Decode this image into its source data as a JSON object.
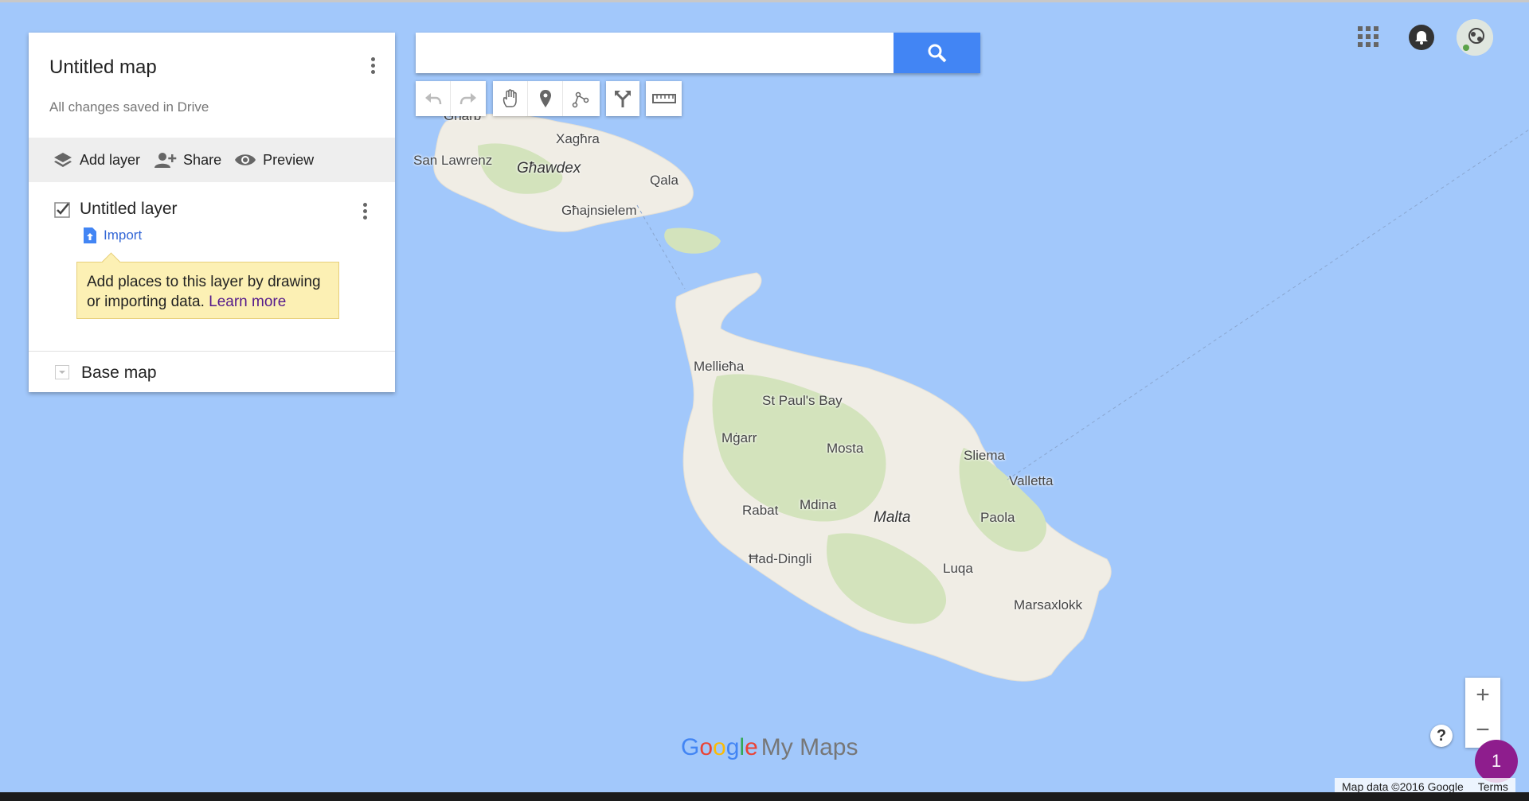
{
  "panel": {
    "map_title": "Untitled map",
    "save_status": "All changes saved in Drive",
    "actions": {
      "add_layer": "Add layer",
      "share": "Share",
      "preview": "Preview"
    },
    "layer": {
      "name": "Untitled layer",
      "checked": true,
      "import_label": "Import",
      "tip_text": "Add places to this layer by drawing or importing data.",
      "tip_link": "Learn more"
    },
    "base_map_label": "Base map"
  },
  "search": {
    "placeholder": ""
  },
  "toolbar": {
    "buttons": [
      "undo-icon",
      "redo-icon",
      "hand-icon",
      "marker-icon",
      "line-icon",
      "directions-icon",
      "ruler-icon"
    ]
  },
  "map_labels": {
    "gharb": "Għarb",
    "xaghra": "Xagħra",
    "san_lawrenz": "San Lawrenz",
    "ghawdex": "Għawdex",
    "qala": "Qala",
    "ghajnsielem": "Għajnsielem",
    "mellieha": "Mellieħa",
    "st_pauls_bay": "St Paul's Bay",
    "mgarr": "Mġarr",
    "mosta": "Mosta",
    "sliema": "Sliema",
    "valletta": "Valletta",
    "rabat": "Rabat",
    "mdina": "Mdina",
    "malta": "Malta",
    "paola": "Paola",
    "had_dingli": "Ħad-Dingli",
    "luqa": "Luqa",
    "marsaxlokk": "Marsaxlokk"
  },
  "logo": {
    "google": "Google",
    "my_maps": "My Maps"
  },
  "zoom": {
    "in": "+",
    "out": "−"
  },
  "help": "?",
  "badge_count": "1",
  "attribution": {
    "map_data": "Map data ©2016 Google",
    "terms": "Terms"
  },
  "colors": {
    "water": "#a2c8fb",
    "land": "#f0ede5",
    "green": "#cfe1b6",
    "accent": "#4285f4",
    "tip_bg": "#fcf0b4",
    "badge": "#8e1d8d"
  }
}
